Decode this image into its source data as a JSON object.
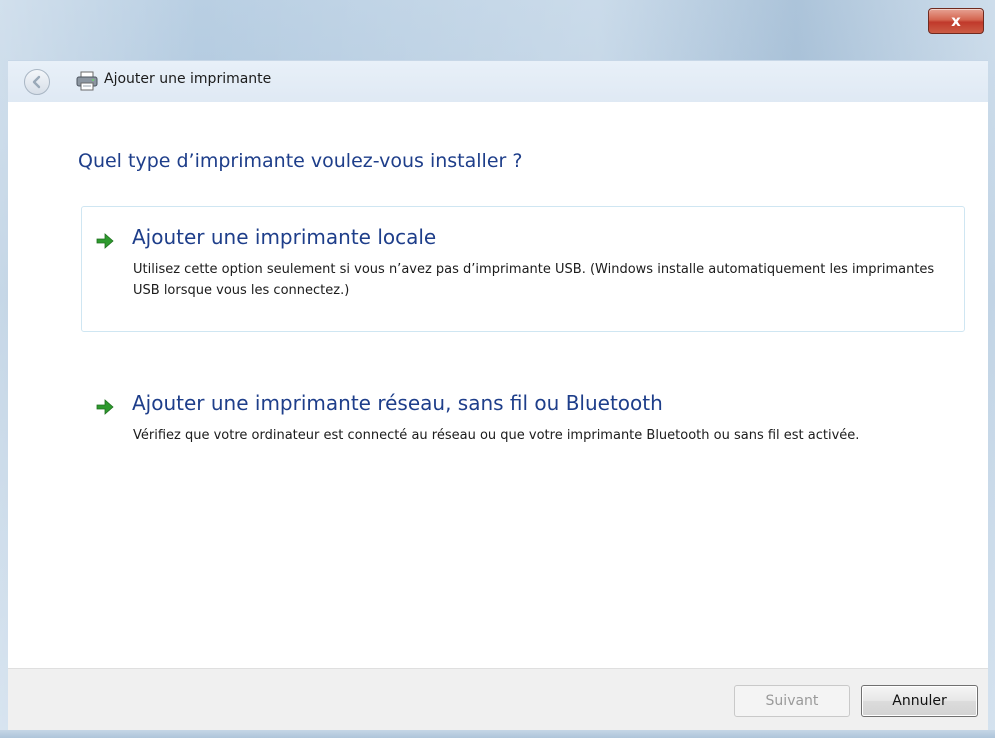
{
  "window": {
    "title": "Ajouter une imprimante",
    "close_label": "x"
  },
  "main": {
    "heading": "Quel type d’imprimante voulez-vous installer ?",
    "options": [
      {
        "title": "Ajouter une imprimante locale",
        "description": "Utilisez cette option seulement si vous n’avez pas d’imprimante USB. (Windows installe automatiquement les imprimantes USB lorsque vous les connectez.)",
        "icon": "green-arrow-icon"
      },
      {
        "title": "Ajouter une imprimante réseau, sans fil ou Bluetooth",
        "description": "Vérifiez que votre ordinateur est connecté au réseau ou que votre imprimante Bluetooth ou sans fil est activée.",
        "icon": "green-arrow-icon"
      }
    ]
  },
  "footer": {
    "next_label": "Suivant",
    "cancel_label": "Annuler"
  },
  "colors": {
    "heading": "#1e3e8a",
    "arrow": "#2e9a2e",
    "close": "#c0392b"
  }
}
